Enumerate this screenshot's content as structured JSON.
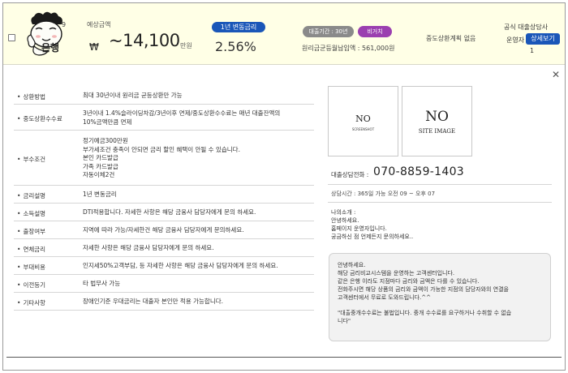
{
  "header": {
    "logo_text": "은행",
    "logo_number": "9",
    "amount_label": "예상금액",
    "currency": "₩",
    "amount_value": "~14,100",
    "amount_unit": "만원",
    "rate_type_badge": "1년 변동금리",
    "rate_value": "2.56%",
    "term_badge": "대출기간 : 30년",
    "category_badge": "비거치",
    "monthly_payment": "원리금균등월납입액 : 561,000원",
    "early_repayment": "중도상환계획 없음",
    "official_label": "공식 대출상담사",
    "operator_label": "운영자",
    "detail_button": "상세보기",
    "operator_count": "1"
  },
  "close_symbol": "✕",
  "info_rows": [
    {
      "key": "상환방법",
      "lines": [
        "최대 30년이내 원리금 균등상환만 가능"
      ]
    },
    {
      "key": "중도상환수수료",
      "lines": [
        "3년이내 1.4%슬라이딩차감/3년이후 면제/중도상환수수료는 매년 대출잔액의",
        "10%금액만큼 면제"
      ]
    },
    {
      "key": "부수조건",
      "lines": [
        "정기예금300만원",
        "부가세조건 충족이 안되면 금리 할인 혜택이 안될 수 있습니다.",
        "본인 카드발급",
        "가족 카드발급",
        "자동이체2건"
      ]
    },
    {
      "key": "금리설명",
      "lines": [
        "1년 변동금리"
      ]
    },
    {
      "key": "소득설명",
      "lines": [
        "DTI적용합니다. 자세한 사항은 해당 금융사 담당자에게 문의 하세요."
      ]
    },
    {
      "key": "출장여부",
      "lines": [
        "지역에 따라 가능/자세한건 해당 금융사 담당자에게 문의하세요."
      ]
    },
    {
      "key": "연체금리",
      "lines": [
        "자세한 사항은 해당 금융사 담당자에게 문의 하세요."
      ]
    },
    {
      "key": "부대비용",
      "lines": [
        "인지세50%고객부담, 등 자세한 사항은 해당 금융사 담당자에게 문의 하세요."
      ]
    },
    {
      "key": "이전등기",
      "lines": [
        "타 법무사 가능"
      ]
    },
    {
      "key": "기타사항",
      "lines": [
        "장애인기준 우대금리는 대출자 본인만 적용 가능합니다."
      ]
    }
  ],
  "image1": {
    "title": "NO",
    "subtitle": "SCREENSHOT"
  },
  "image2": {
    "title": "NO",
    "subtitle": "SITE IMAGE"
  },
  "contact": {
    "phone_label": "대출상담전화 :",
    "phone_number": "070-8859-1403",
    "hours": "상담시간 : 365일 가능 오전 09 ~ 오후 07",
    "intro_lines": [
      "나의소개 :",
      "안녕하세요.",
      "홈페이지 운영자입니다.",
      "궁금하신 점 언제든지 문의하세요.."
    ]
  },
  "notice": {
    "lines": [
      "안녕하세요.",
      "해당 금리비교시스템을 운영하는 고객센터입니다.",
      "같은 은행 이라도 지점마다 금리와 금액은 다를 수 있습니다.",
      "전화주시면 해당 상품의 금리와 금액이 가능한 지점의 담당자와의 연결을",
      "고객센터에서 무료로 도와드립니다.^^"
    ],
    "warning_lines": [
      "\"대출중개수수료는 불법입니다. 중개 수수료를 요구하거나 수취할 수 없습",
      "니다\""
    ]
  }
}
